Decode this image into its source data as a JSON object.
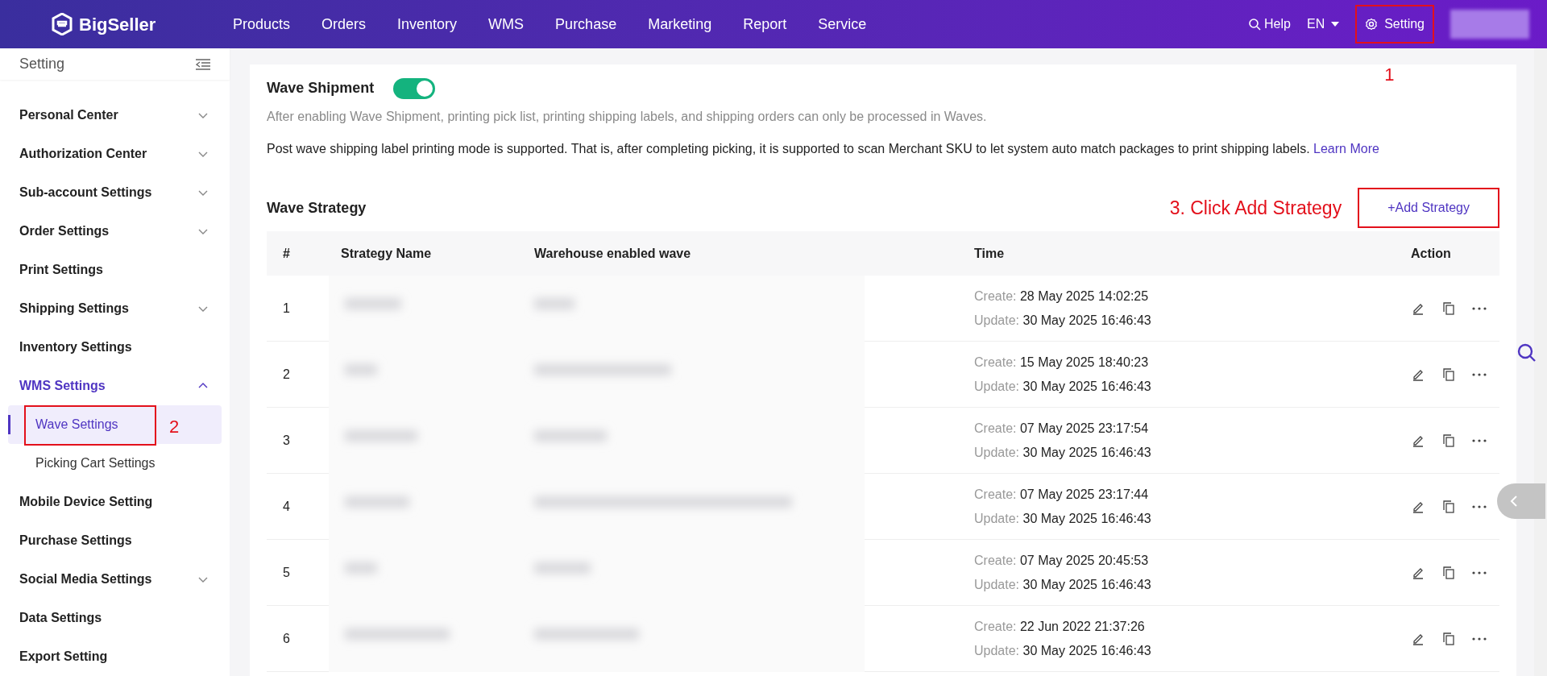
{
  "header": {
    "logo": "BigSeller",
    "nav": [
      {
        "label": "Products"
      },
      {
        "label": "Orders"
      },
      {
        "label": "Inventory"
      },
      {
        "label": "WMS"
      },
      {
        "label": "Purchase"
      },
      {
        "label": "Marketing"
      },
      {
        "label": "Report"
      },
      {
        "label": "Service"
      }
    ],
    "help": "Help",
    "language": "EN",
    "setting": "Setting",
    "setting_annotation": "1"
  },
  "sidebar": {
    "title": "Setting",
    "items": [
      {
        "label": "Personal Center",
        "expandable": true,
        "expanded": false
      },
      {
        "label": "Authorization Center",
        "expandable": true,
        "expanded": false
      },
      {
        "label": "Sub-account Settings",
        "expandable": true,
        "expanded": false
      },
      {
        "label": "Order Settings",
        "expandable": true,
        "expanded": false
      },
      {
        "label": "Print Settings",
        "expandable": false,
        "expanded": false
      },
      {
        "label": "Shipping Settings",
        "expandable": true,
        "expanded": false
      },
      {
        "label": "Inventory Settings",
        "expandable": false,
        "expanded": false
      },
      {
        "label": "WMS Settings",
        "expandable": true,
        "expanded": true,
        "children": [
          {
            "label": "Wave Settings",
            "selected": true,
            "annotation": "2"
          },
          {
            "label": "Picking Cart Settings",
            "selected": false
          }
        ]
      },
      {
        "label": "Mobile Device Setting",
        "expandable": false,
        "expanded": false
      },
      {
        "label": "Purchase Settings",
        "expandable": false,
        "expanded": false
      },
      {
        "label": "Social Media Settings",
        "expandable": true,
        "expanded": false
      },
      {
        "label": "Data Settings",
        "expandable": false,
        "expanded": false
      },
      {
        "label": "Export Setting",
        "expandable": false,
        "expanded": false
      }
    ]
  },
  "wave_shipment": {
    "title": "Wave Shipment",
    "on": true,
    "hint": "After enabling Wave Shipment, printing pick list, printing shipping labels, and shipping orders can only be processed in Waves.",
    "note": "Post wave shipping label printing mode is supported. That is, after completing picking, it is supported to scan Merchant SKU to let system auto match packages to print shipping labels.",
    "link": "Learn More"
  },
  "wave_strategy": {
    "title": "Wave Strategy",
    "add_annotation": "3. Click Add Strategy",
    "add_button": "+Add Strategy",
    "columns": [
      "#",
      "Strategy Name",
      "Warehouse enabled wave",
      "Time",
      "Action"
    ],
    "rows": [
      {
        "index": "1",
        "create_label": "Create:",
        "created": "28 May 2025 14:02:25",
        "update_label": "Update:",
        "updated": "30 May 2025 16:46:43"
      },
      {
        "index": "2",
        "create_label": "Create:",
        "created": "15 May 2025 18:40:23",
        "update_label": "Update:",
        "updated": "30 May 2025 16:46:43"
      },
      {
        "index": "3",
        "create_label": "Create:",
        "created": "07 May 2025 23:17:54",
        "update_label": "Update:",
        "updated": "30 May 2025 16:46:43"
      },
      {
        "index": "4",
        "create_label": "Create:",
        "created": "07 May 2025 23:17:44",
        "update_label": "Update:",
        "updated": "30 May 2025 16:46:43"
      },
      {
        "index": "5",
        "create_label": "Create:",
        "created": "07 May 2025 20:45:53",
        "update_label": "Update:",
        "updated": "30 May 2025 16:46:43"
      },
      {
        "index": "6",
        "create_label": "Create:",
        "created": "22 Jun 2022 21:37:26",
        "update_label": "Update:",
        "updated": "30 May 2025 16:46:43"
      }
    ]
  }
}
